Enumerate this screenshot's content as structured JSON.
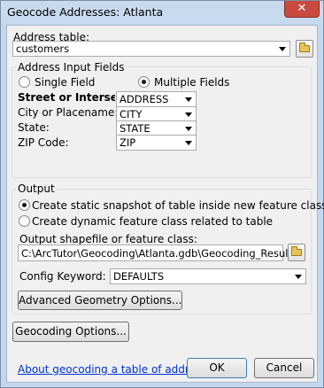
{
  "window": {
    "title": "Geocode Addresses: Atlanta",
    "close_glyph": "✕"
  },
  "address_table": {
    "label": "Address table:",
    "value": "customers"
  },
  "address_input_fields": {
    "legend": "Address Input Fields",
    "single_field_label": "Single Field",
    "multiple_fields_label": "Multiple Fields",
    "selected_mode": "Multiple Fields",
    "rows": [
      {
        "label": "Street or Intersection:",
        "value": "ADDRESS"
      },
      {
        "label": "City or Placename:",
        "value": "CITY"
      },
      {
        "label": "State:",
        "value": "STATE"
      },
      {
        "label": "ZIP Code:",
        "value": "ZIP"
      }
    ]
  },
  "output": {
    "legend": "Output",
    "static_snapshot_label": "Create static snapshot of table inside new feature class",
    "dynamic_class_label": "Create dynamic feature class related to table",
    "selected_option": "Create static snapshot of table inside new feature class",
    "output_path_label": "Output shapefile or feature class:",
    "output_path_value": "C:\\ArcTutor\\Geocoding\\Atlanta.gdb\\Geocoding_Result",
    "config_keyword_label": "Config Keyword:",
    "config_keyword_value": "DEFAULTS",
    "advanced_geometry_label": "Advanced Geometry Options..."
  },
  "footer": {
    "geocoding_options_label": "Geocoding Options...",
    "help_link": "About geocoding a table of addresses",
    "ok_label": "OK",
    "cancel_label": "Cancel"
  },
  "icons": {
    "browse": "folder-icon",
    "dropdown": "chevron-down-icon"
  }
}
